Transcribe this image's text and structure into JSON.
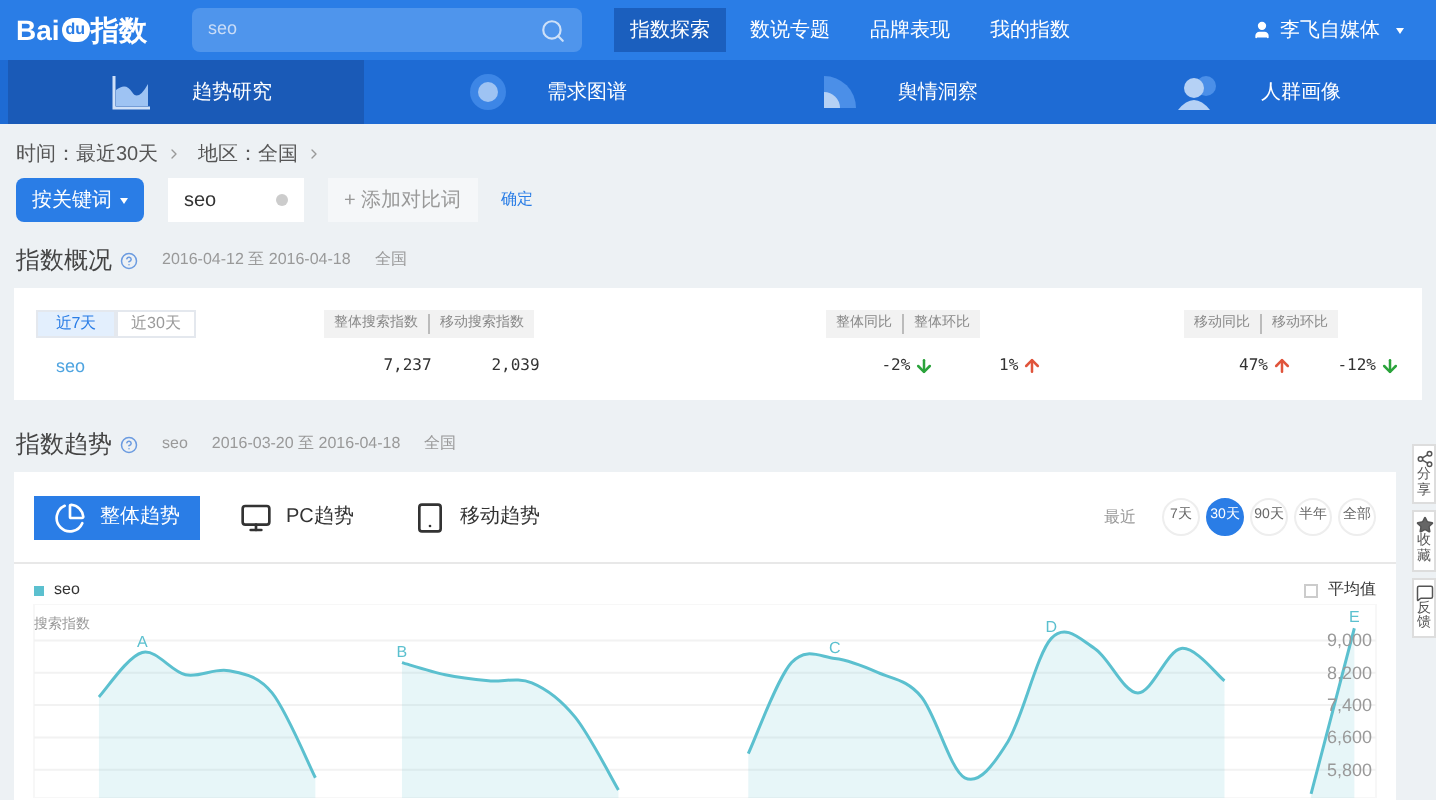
{
  "header": {
    "logo": {
      "latin": "Bai",
      "badge": "du",
      "cjk": "指数"
    },
    "search": {
      "value": "seo"
    },
    "nav": [
      {
        "label": "指数探索",
        "selected": true
      },
      {
        "label": "数说专题",
        "selected": false
      },
      {
        "label": "品牌表现",
        "selected": false
      },
      {
        "label": "我的指数",
        "selected": false
      }
    ],
    "user": "李飞自媒体"
  },
  "subnav": [
    {
      "label": "趋势研究",
      "selected": true
    },
    {
      "label": "需求图谱",
      "selected": false
    },
    {
      "label": "舆情洞察",
      "selected": false
    },
    {
      "label": "人群画像",
      "selected": false
    }
  ],
  "filters": [
    {
      "label": "时间：最近30天"
    },
    {
      "label": "地区：全国"
    }
  ],
  "controls": {
    "mode": "按关键词",
    "keyword": "seo",
    "add": "+ 添加对比词",
    "confirm": "确定"
  },
  "overview": {
    "title": "指数概况",
    "range": "2016-04-12 至 2016-04-18",
    "region": "全国",
    "periods": [
      {
        "label": "近7天",
        "selected": true
      },
      {
        "label": "近30天",
        "selected": false
      }
    ],
    "groups": [
      {
        "headers": [
          "整体搜索指数",
          "移动搜索指数"
        ],
        "cells": [
          {
            "text": "7,237"
          },
          {
            "text": "2,039"
          }
        ]
      },
      {
        "headers": [
          "整体同比",
          "整体环比"
        ],
        "cells": [
          {
            "text": "-2%",
            "kind": "down"
          },
          {
            "text": "1%",
            "kind": "up"
          }
        ]
      },
      {
        "headers": [
          "移动同比",
          "移动环比"
        ],
        "cells": [
          {
            "text": "47%",
            "kind": "up"
          },
          {
            "text": "-12%",
            "kind": "down"
          }
        ]
      }
    ],
    "keyword": "seo"
  },
  "trend": {
    "title": "指数趋势",
    "keyword": "seo",
    "range": "2016-03-20 至 2016-04-18",
    "region": "全国",
    "tabs": [
      {
        "label": "整体趋势",
        "selected": true
      },
      {
        "label": "PC趋势",
        "selected": false
      },
      {
        "label": "移动趋势",
        "selected": false
      }
    ],
    "recent_label": "最近",
    "ranges": [
      {
        "label": "7天",
        "selected": false
      },
      {
        "label": "30天",
        "selected": true
      },
      {
        "label": "90天",
        "selected": false
      },
      {
        "label": "半年",
        "selected": false
      },
      {
        "label": "全部",
        "selected": false
      }
    ],
    "average": {
      "label": "平均值",
      "checked": false
    },
    "peak_labels": [
      "A",
      "B",
      "C",
      "D",
      "E"
    ],
    "chart_data": {
      "type": "area",
      "ylabel": "搜索指数",
      "grid": true,
      "ylim": [
        5100,
        9900
      ],
      "yticks": [
        {
          "value": 9000,
          "label": "9,000"
        },
        {
          "value": 8200,
          "label": "8,200"
        },
        {
          "value": 7400,
          "label": "7,400"
        },
        {
          "value": 6600,
          "label": "6,600"
        },
        {
          "value": 5800,
          "label": "5,800"
        }
      ],
      "series": [
        {
          "name": "seo",
          "color": "#5bc0cf",
          "values": [
            null,
            7600,
            8700,
            8150,
            8250,
            7700,
            5600,
            null,
            8450,
            8150,
            8000,
            7950,
            7100,
            5300,
            null,
            null,
            6200,
            8450,
            8550,
            8200,
            7600,
            5600,
            6500,
            9050,
            8800,
            7700,
            8800,
            8000,
            null,
            5200,
            9300
          ]
        }
      ]
    }
  },
  "side_tools": [
    {
      "label": "分享"
    },
    {
      "label": "收藏"
    },
    {
      "label": "反馈"
    }
  ]
}
